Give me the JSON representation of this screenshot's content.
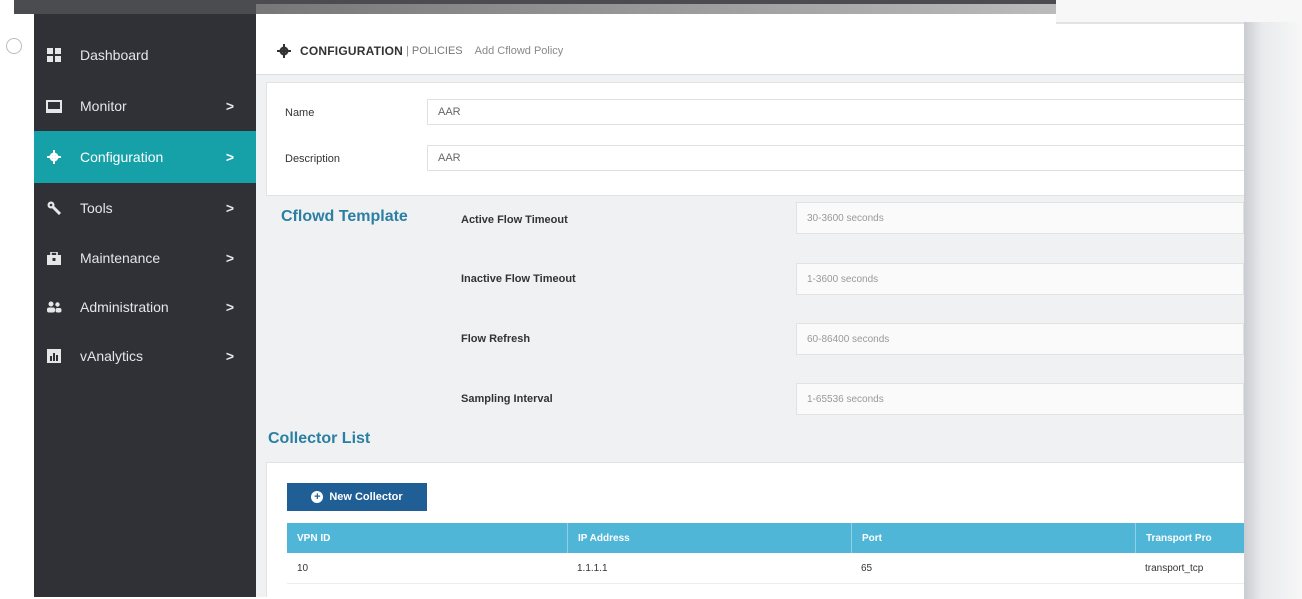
{
  "sidebar": {
    "items": [
      {
        "label": "Dashboard",
        "icon": "dashboard-icon",
        "chevron": ""
      },
      {
        "label": "Monitor",
        "icon": "monitor-icon",
        "chevron": ">"
      },
      {
        "label": "Configuration",
        "icon": "gear-icon",
        "chevron": ">",
        "active": true
      },
      {
        "label": "Tools",
        "icon": "wrench-icon",
        "chevron": ">"
      },
      {
        "label": "Maintenance",
        "icon": "toolbox-icon",
        "chevron": ">"
      },
      {
        "label": "Administration",
        "icon": "users-icon",
        "chevron": ">"
      },
      {
        "label": "vAnalytics",
        "icon": "analytics-icon",
        "chevron": ">"
      }
    ]
  },
  "header": {
    "title": "CONFIGURATION",
    "separator": "|",
    "subtitle": "POLICIES",
    "action": "Add Cflowd Policy"
  },
  "form": {
    "name_label": "Name",
    "name_value": "AAR",
    "description_label": "Description",
    "description_value": "AAR"
  },
  "cflowd_template": {
    "title": "Cflowd Template",
    "fields": [
      {
        "label": "Active Flow Timeout",
        "placeholder": "30-3600 seconds"
      },
      {
        "label": "Inactive Flow Timeout",
        "placeholder": "1-3600 seconds"
      },
      {
        "label": "Flow Refresh",
        "placeholder": "60-86400 seconds"
      },
      {
        "label": "Sampling Interval",
        "placeholder": "1-65536 seconds"
      }
    ]
  },
  "collector_list": {
    "title": "Collector List",
    "new_button": "New Collector",
    "columns": [
      "VPN ID",
      "IP Address",
      "Port",
      "Transport Pro"
    ],
    "rows": [
      [
        "10",
        "1.1.1.1",
        "65",
        "transport_tcp"
      ]
    ]
  },
  "colors": {
    "sidebar_bg": "#2f3136",
    "active_item": "#16a0a8",
    "section_title": "#2a7fa3",
    "table_header": "#4fb6d8",
    "primary_button": "#1f5f95"
  }
}
